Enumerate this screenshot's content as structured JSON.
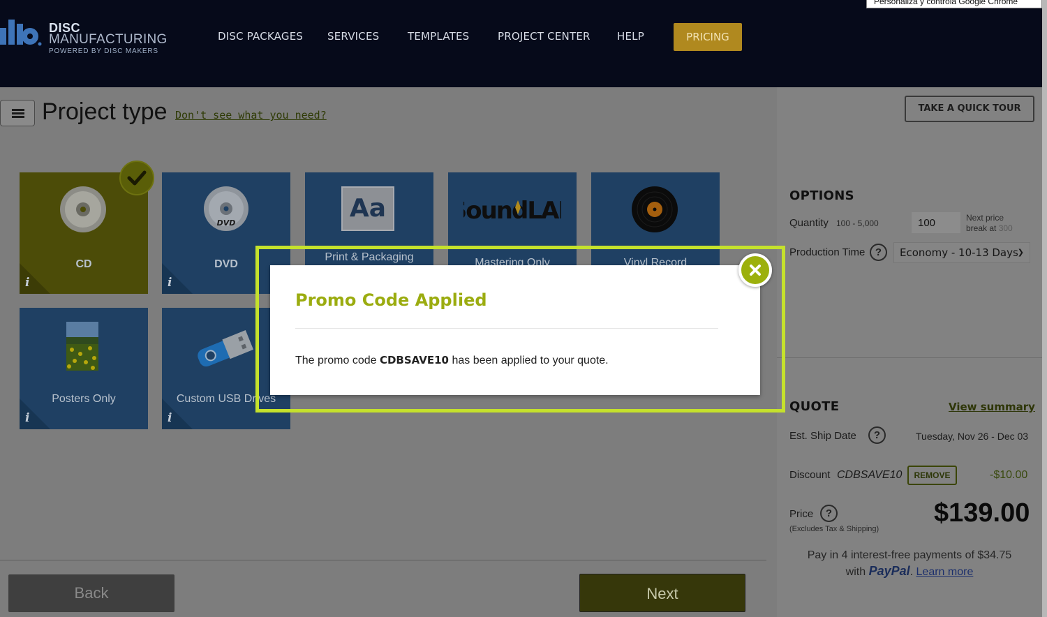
{
  "browser": {
    "tooltip": "Personaliza y controla Google Chrome"
  },
  "header": {
    "logo": {
      "line1": "DISC",
      "line2": "MANUFACTURING",
      "line3": "POWERED BY DISC MAKERS"
    },
    "nav": [
      "DISC PACKAGES",
      "SERVICES",
      "TEMPLATES",
      "PROJECT CENTER",
      "HELP"
    ],
    "pricing": "PRICING"
  },
  "main": {
    "title": "Project type",
    "help_link": "Don't see what you need?",
    "tiles": [
      {
        "label": "CD",
        "icon": "cd-disc-icon",
        "selected": true
      },
      {
        "label": "DVD",
        "icon": "dvd-disc-icon",
        "selected": false
      },
      {
        "label": "Print & Packaging",
        "icon": "aa-typography-icon",
        "selected": false
      },
      {
        "label": "Mastering Only",
        "icon": "soundlab-logo",
        "selected": false
      },
      {
        "label": "Vinyl Record",
        "icon": "vinyl-record-icon",
        "selected": false
      },
      {
        "label": "Posters Only",
        "icon": "poster-image-icon",
        "selected": false
      },
      {
        "label": "Custom USB Drives",
        "icon": "usb-drive-icon",
        "selected": false
      }
    ]
  },
  "sidebar": {
    "tour_button": "TAKE A QUICK TOUR",
    "options": {
      "title": "OPTIONS",
      "quantity_label": "Quantity",
      "quantity_range": "100 - 5,000",
      "quantity_value": "100",
      "next_break_line1": "Next price",
      "next_break_line2": "break at",
      "next_break_value": "300",
      "production_label": "Production Time",
      "production_value": "Economy - 10-13 Days"
    },
    "quote": {
      "title": "QUOTE",
      "view_summary": "View summary",
      "ship_label": "Est. Ship Date",
      "ship_value": "Tuesday, Nov 26 - Dec 03",
      "discount_label": "Discount",
      "discount_code": "CDBSAVE10",
      "remove": "REMOVE",
      "discount_value": "-$10.00",
      "price_label": "Price",
      "price_note": "(Excludes Tax & Shipping)",
      "price_value": "$139.00",
      "paypal_line1": "Pay in 4 interest-free payments of $34.75",
      "paypal_with": "with",
      "paypal_brand": "PayPal",
      "paypal_dot": ".",
      "learn_more": "Learn more"
    }
  },
  "footer": {
    "back": "Back",
    "next": "Next"
  },
  "modal": {
    "title": "Promo Code Applied",
    "msg_prefix": "The promo code",
    "msg_code": "CDBSAVE10",
    "msg_suffix": "has been applied to your quote."
  },
  "colors": {
    "header_bg": "#060a1a",
    "pricing": "#b0891f",
    "accent_green": "#9bac10",
    "modal_outline": "#c5e12c",
    "tile_blue": "#1f4063"
  }
}
